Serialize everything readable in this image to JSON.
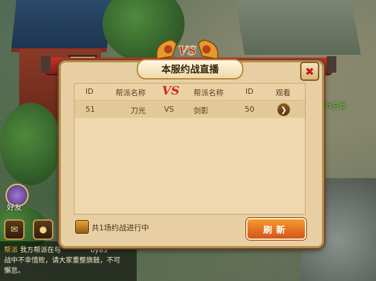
{
  "background": {
    "gate_plaque": "義",
    "avatar_label": "好友",
    "npc_labels": [
      "游戏总管"
    ],
    "chat": {
      "line1_channel": "帮派",
      "line1_text": "我方帮派在与",
      "line1_extra": "by83",
      "line2": "战中不幸惜败，请大家重整旗鼓，不可",
      "line3": "懈怠。"
    }
  },
  "dialog": {
    "title": "本服约战直播",
    "vs_emblem": "VS",
    "close_icon": "close-icon",
    "table": {
      "headers": {
        "id_left": "ID",
        "guild_left": "帮派名称",
        "vs": "VS",
        "guild_right": "帮派名称",
        "id_right": "ID",
        "watch": "观看"
      },
      "rows": [
        {
          "id_left": "51",
          "guild_left": "刀光",
          "vs": "VS",
          "guild_right": "剑影",
          "id_right": "50",
          "watch_icon": "chevron-right-icon"
        }
      ]
    },
    "footer_text": "共1场约战进行中",
    "refresh_label": "刷新"
  },
  "colors": {
    "ribbon": "#c6312a",
    "panel": "#efd7ae",
    "vs": "#d32b18",
    "refresh": "#f59a2e"
  }
}
